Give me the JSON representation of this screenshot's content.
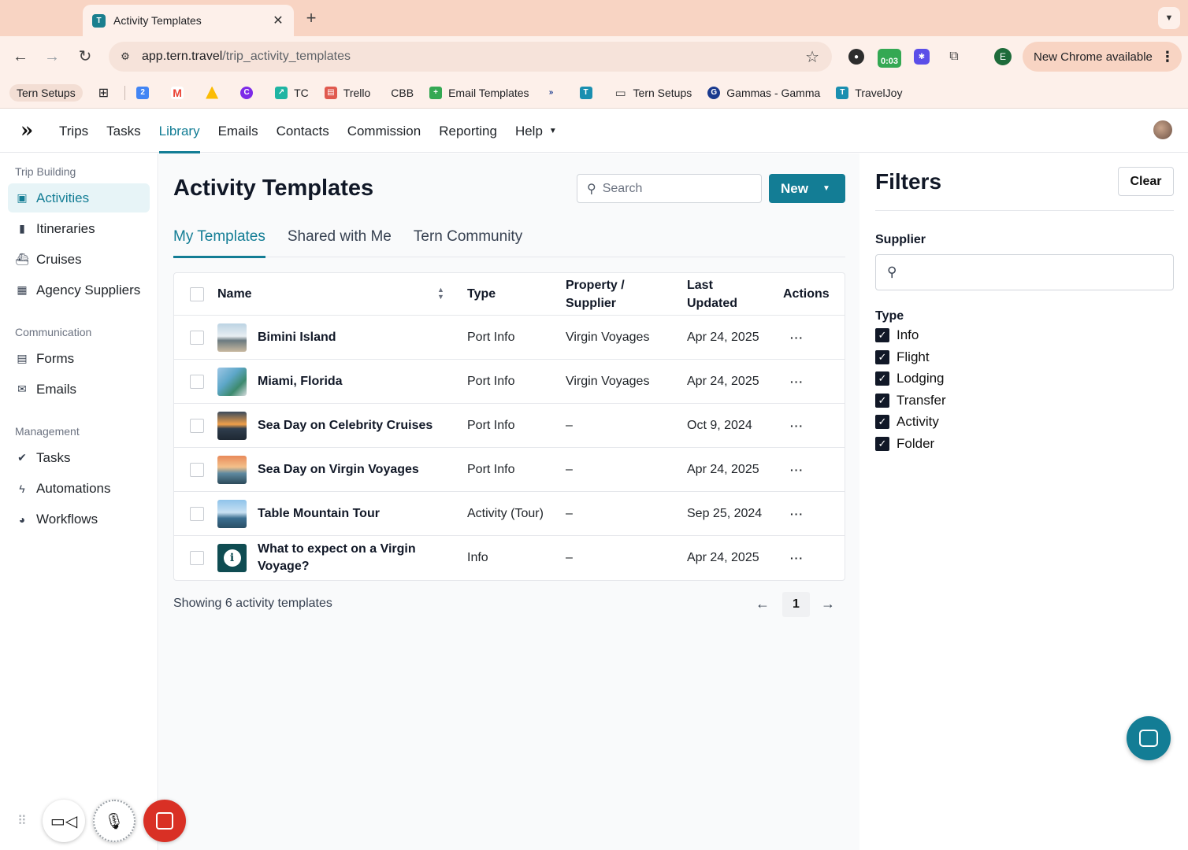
{
  "browser": {
    "tab_title": "Activity Templates",
    "url_host": "app.tern.travel",
    "url_path": "/trip_activity_templates",
    "timer": "0:03",
    "profile_initial": "E",
    "update_label": "New Chrome available"
  },
  "bookmarks": [
    {
      "label": "Tern Setups"
    },
    {
      "label": "TC"
    },
    {
      "label": "Trello"
    },
    {
      "label": "CBB"
    },
    {
      "label": "Email Templates"
    },
    {
      "label": "Tern Setups"
    },
    {
      "label": "Gammas - Gamma"
    },
    {
      "label": "TravelJoy"
    }
  ],
  "nav": {
    "items": [
      "Trips",
      "Tasks",
      "Library",
      "Emails",
      "Contacts",
      "Commission",
      "Reporting",
      "Help"
    ]
  },
  "sidebar": {
    "sections": [
      {
        "title": "Trip Building",
        "items": [
          "Activities",
          "Itineraries",
          "Cruises",
          "Agency Suppliers"
        ]
      },
      {
        "title": "Communication",
        "items": [
          "Forms",
          "Emails"
        ]
      },
      {
        "title": "Management",
        "items": [
          "Tasks",
          "Automations",
          "Workflows"
        ]
      }
    ]
  },
  "main": {
    "title": "Activity Templates",
    "search_placeholder": "Search",
    "new_label": "New",
    "tabs": [
      "My Templates",
      "Shared with Me",
      "Tern Community"
    ],
    "columns": {
      "name": "Name",
      "type": "Type",
      "supplier": "Property / Supplier",
      "updated": "Last Updated",
      "actions": "Actions"
    },
    "rows": [
      {
        "name": "Bimini Island",
        "type": "Port Info",
        "supplier": "Virgin Voyages",
        "updated": "Apr 24, 2025",
        "actions": "···"
      },
      {
        "name": "Miami, Florida",
        "type": "Port Info",
        "supplier": "Virgin Voyages",
        "updated": "Apr 24, 2025",
        "actions": "···"
      },
      {
        "name": "Sea Day on Celebrity Cruises",
        "type": "Port Info",
        "supplier": "–",
        "updated": "Oct 9, 2024",
        "actions": "···"
      },
      {
        "name": "Sea Day on Virgin Voyages",
        "type": "Port Info",
        "supplier": "–",
        "updated": "Apr 24, 2025",
        "actions": "···"
      },
      {
        "name": "Table Mountain Tour",
        "type": "Activity (Tour)",
        "supplier": "–",
        "updated": "Sep 25, 2024",
        "actions": "···"
      },
      {
        "name": "What to expect on a Virgin Voyage?",
        "type": "Info",
        "supplier": "–",
        "updated": "Apr 24, 2025",
        "actions": "···"
      }
    ],
    "showing": "Showing 6 activity templates",
    "page": "1"
  },
  "filters": {
    "title": "Filters",
    "clear_label": "Clear",
    "supplier_label": "Supplier",
    "type_label": "Type",
    "types": [
      "Info",
      "Flight",
      "Lodging",
      "Transfer",
      "Activity",
      "Folder"
    ]
  },
  "colors": {
    "accent": "#137d95",
    "tab_strip": "#f8d4c3"
  }
}
